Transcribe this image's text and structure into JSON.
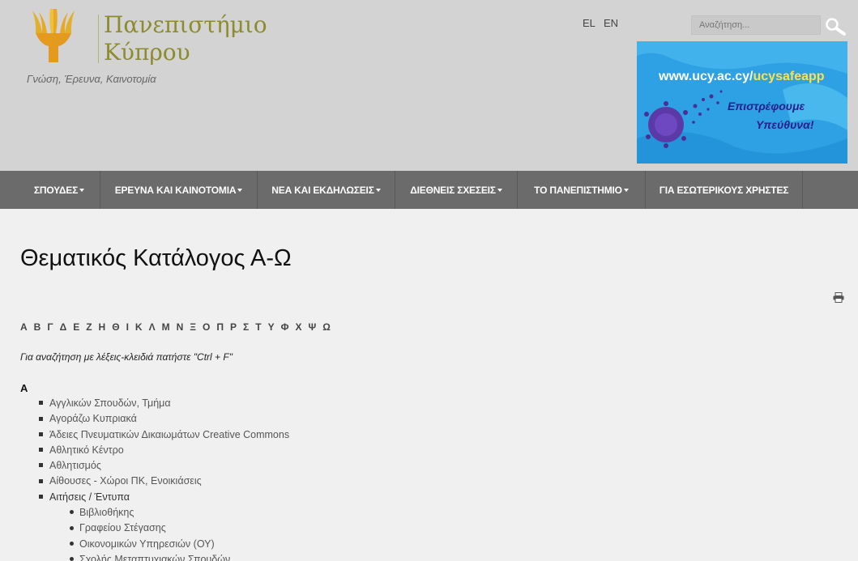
{
  "header": {
    "logo_icon": "ucy-tree-logo-icon",
    "logo_line1": "Πανεπιστήμιο",
    "logo_line2": "Κύπρου",
    "tagline": "Γνώση, Έρευνα, Καινοτομία",
    "lang_el": "EL",
    "lang_en": "EN",
    "search_placeholder": "Αναζήτηση...",
    "search_icon": "search-icon"
  },
  "banner": {
    "url_prefix": "www.ucy.ac.cy/",
    "url_accent": "ucysafeapp",
    "line1": "Επιστρέφουμε",
    "line2": "Υπεύθυνα!"
  },
  "nav": {
    "items": [
      {
        "label": "ΣΠΟΥΔΕΣ",
        "dropdown": true
      },
      {
        "label": "ΕΡΕΥΝΑ ΚΑΙ ΚΑΙΝΟΤΟΜΙΑ",
        "dropdown": true
      },
      {
        "label": "ΝΕΑ ΚΑΙ ΕΚΔΗΛΩΣΕΙΣ",
        "dropdown": true
      },
      {
        "label": "ΔΙΕΘΝΕΙΣ ΣΧΕΣΕΙΣ",
        "dropdown": true
      },
      {
        "label": "ΤΟ ΠΑΝΕΠΙΣΤΗΜΙΟ",
        "dropdown": true
      },
      {
        "label": "ΓΙΑ ΕΣΩΤΕΡΙΚΟΥΣ ΧΡΗΣΤΕΣ",
        "dropdown": false
      }
    ]
  },
  "main": {
    "title": "Θεματικός Κατάλογος Α-Ω",
    "print_icon": "printer-icon",
    "alphabet": [
      "Α",
      "Β",
      "Γ",
      "Δ",
      "Ε",
      "Ζ",
      "Η",
      "Θ",
      "Ι",
      "Κ",
      "Λ",
      "Μ",
      "Ν",
      "Ξ",
      "Ο",
      "Π",
      "Ρ",
      "Σ",
      "Τ",
      "Υ",
      "Φ",
      "Χ",
      "Ψ",
      "Ω"
    ],
    "hint": "Για αναζήτηση με λέξεις-κλειδιά πατήστε \"Ctrl + F\"",
    "section_letter": "Α",
    "items": [
      "Αγγλικών Σπουδών, Τμήμα",
      "Αγοράζω Κυπριακά",
      "Άδειες Πνευματικών Δικαιωμάτων Creative Commons",
      "Αθλητικό Κέντρο",
      "Αθλητισμός",
      "Αίθουσες - Χώροι ΠΚ, Ενοικιάσεις",
      "Αιτήσεις / Έντυπα"
    ],
    "subitems": [
      "Βιβλιοθήκης",
      "Γραφείου Στέγασης",
      "Οικονομικών Υπηρεσιών (ΟΥ)",
      "Σχολής Μεταπτυχιακών Σπουδών"
    ]
  }
}
